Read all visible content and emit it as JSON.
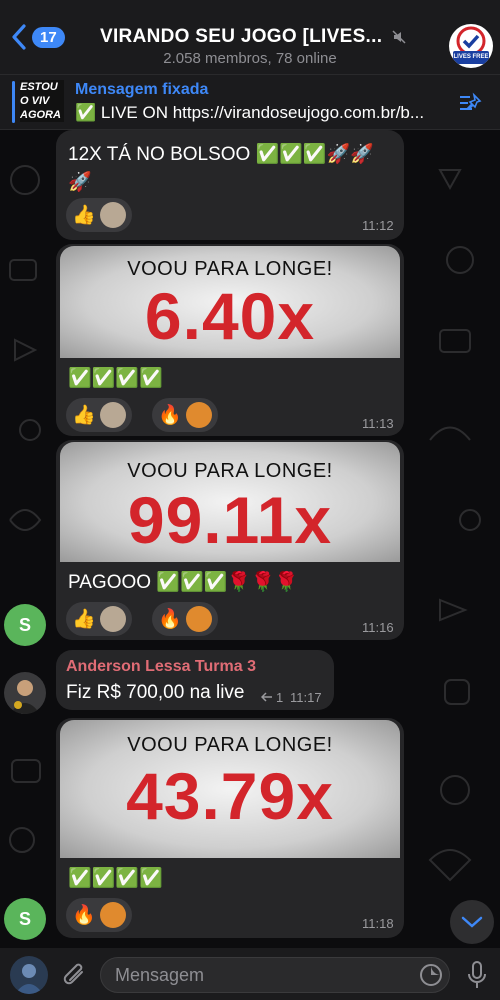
{
  "header": {
    "back_count": "17",
    "title": "VIRANDO SEU JOGO [LIVES...",
    "subtitle": "2.058 membros, 78 online",
    "avatar_text": "LIVES FREE"
  },
  "pinned": {
    "title": "Mensagem fixada",
    "text": "✅ LIVE ON https://virandoseujogo.com.br/b...",
    "thumb_lines": [
      "ESTOU",
      "O VIV",
      "AGORA"
    ]
  },
  "messages": [
    {
      "text": "12X TÁ NO BOLSOO ✅✅✅🚀🚀",
      "text_wrap": "🚀",
      "reactions": [
        "👍"
      ],
      "time": "11:12"
    },
    {
      "media_title": "VOOU PARA LONGE!",
      "multiplier": "6.40x",
      "text": "✅✅✅✅",
      "reactions": [
        "👍",
        "🔥"
      ],
      "time": "11:13"
    },
    {
      "media_title": "VOOU PARA LONGE!",
      "multiplier": "99.11x",
      "text": "PAGOOO ✅✅✅🌹🌹🌹",
      "reactions": [
        "👍",
        "🔥"
      ],
      "time": "11:16",
      "sender_initial": "S"
    },
    {
      "sender": "Anderson Lessa Turma 3",
      "text": "Fiz R$ 700,00 na live",
      "reply_count": "1",
      "time": "11:17"
    },
    {
      "media_title": "VOOU PARA LONGE!",
      "multiplier": "43.79x",
      "text": "✅✅✅✅",
      "reactions": [
        "🔥"
      ],
      "time": "11:18",
      "sender_initial": "S"
    }
  ],
  "input": {
    "placeholder": "Mensagem"
  },
  "colors": {
    "accent": "#3e88f7",
    "multiplier": "#d3252b",
    "bubble": "#262628",
    "sender_name": "#e06c75"
  }
}
